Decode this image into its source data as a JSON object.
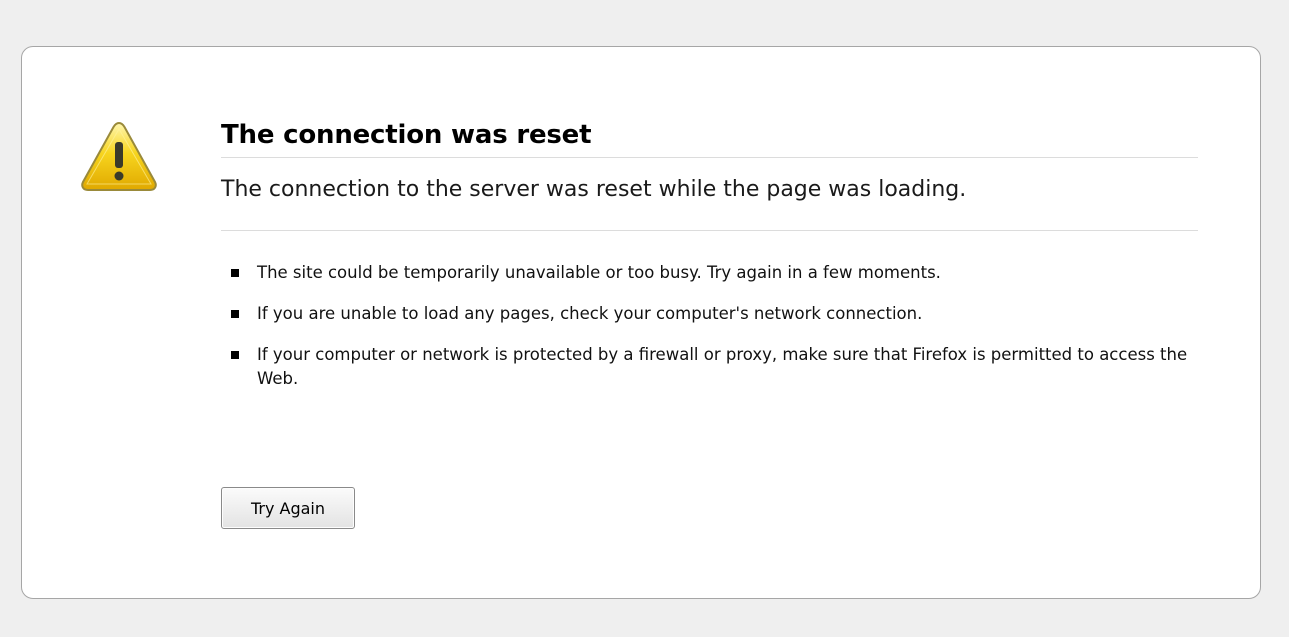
{
  "error": {
    "icon": "warning-triangle-icon",
    "title": "The connection was reset",
    "short_desc": "The connection to the server was reset while the page was loading.",
    "reasons": [
      "The site could be temporarily unavailable or too busy. Try again in a few moments.",
      "If you are unable to load any pages, check your computer's network connection.",
      "If your computer or network is protected by a firewall or proxy, make sure that Firefox is permitted to access the Web."
    ],
    "try_again_label": "Try Again"
  },
  "colors": {
    "page_background": "#efefef",
    "box_background": "#ffffff",
    "box_border": "#a6a6a6",
    "warning_yellow": "#f5c400",
    "warning_border": "#8a7a2a"
  }
}
